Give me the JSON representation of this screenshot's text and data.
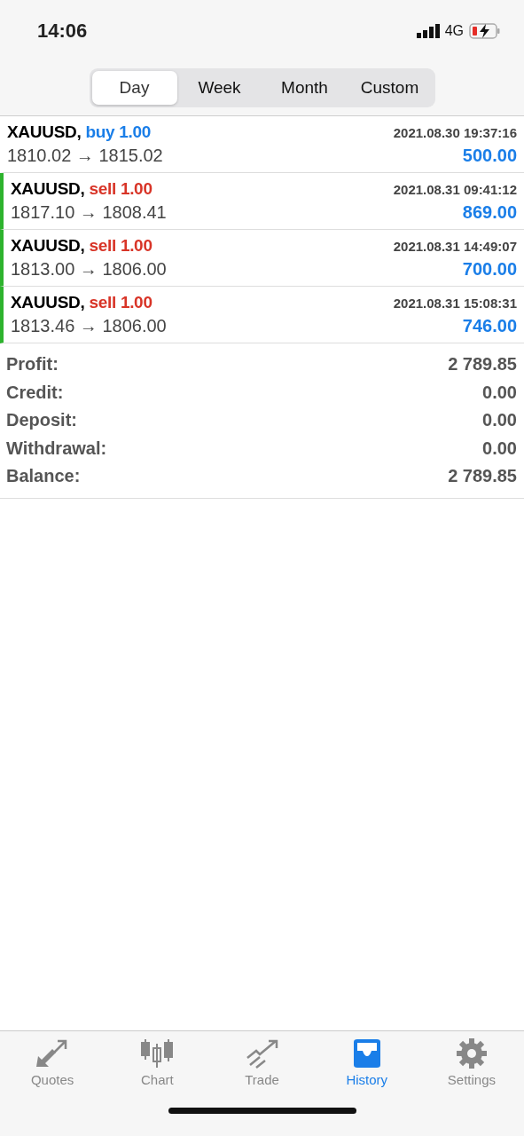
{
  "status_bar": {
    "time": "14:06",
    "network": "4G"
  },
  "tabs": [
    {
      "label": "Day",
      "selected": true
    },
    {
      "label": "Week",
      "selected": false
    },
    {
      "label": "Month",
      "selected": false
    },
    {
      "label": "Custom",
      "selected": false
    }
  ],
  "deals": [
    {
      "symbol": "XAUUSD,",
      "kind": "buy",
      "order": "buy 1.00",
      "time": "2021.08.30 19:37:16",
      "prices": "1810.02 → 1815.02",
      "profit": "500.00"
    },
    {
      "symbol": "XAUUSD,",
      "kind": "sell",
      "order": "sell 1.00",
      "time": "2021.08.31 09:41:12",
      "prices": "1817.10 → 1808.41",
      "profit": "869.00"
    },
    {
      "symbol": "XAUUSD,",
      "kind": "sell",
      "order": "sell 1.00",
      "time": "2021.08.31 14:49:07",
      "prices": "1813.00 → 1806.00",
      "profit": "700.00"
    },
    {
      "symbol": "XAUUSD,",
      "kind": "sell",
      "order": "sell 1.00",
      "time": "2021.08.31 15:08:31",
      "prices": "1813.46 → 1806.00",
      "profit": "746.00"
    }
  ],
  "summary": [
    {
      "label": "Profit:",
      "value": "2 789.85"
    },
    {
      "label": "Credit:",
      "value": "0.00"
    },
    {
      "label": "Deposit:",
      "value": "0.00"
    },
    {
      "label": "Withdrawal:",
      "value": "0.00"
    },
    {
      "label": "Balance:",
      "value": "2 789.85"
    }
  ],
  "nav": [
    {
      "label": "Quotes",
      "selected": false
    },
    {
      "label": "Chart",
      "selected": false
    },
    {
      "label": "Trade",
      "selected": false
    },
    {
      "label": "History",
      "selected": true
    },
    {
      "label": "Settings",
      "selected": false
    }
  ]
}
